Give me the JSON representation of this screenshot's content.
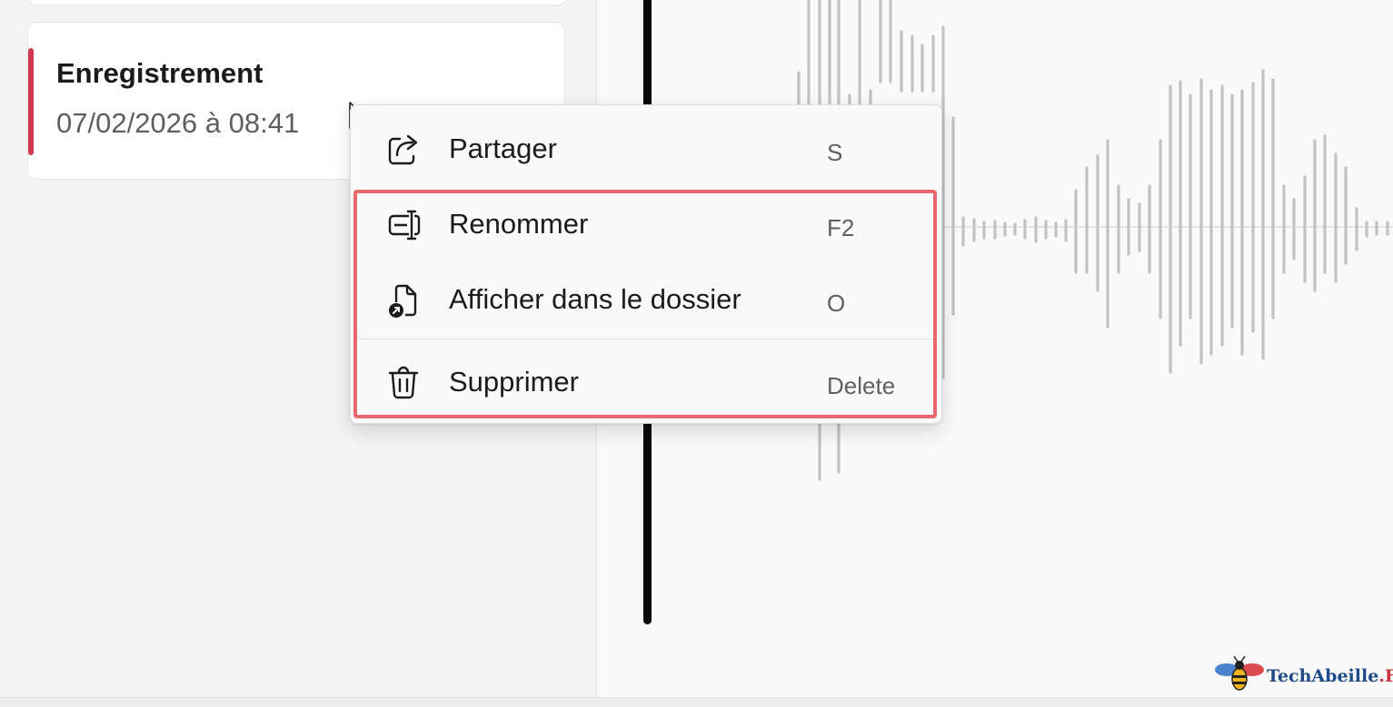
{
  "recording": {
    "title": "Enregistrement",
    "date": "07/02/2026 à 08:41"
  },
  "context_menu": {
    "items": [
      {
        "label": "Partager",
        "shortcut": "S",
        "icon": "share-icon"
      },
      {
        "label": "Renommer",
        "shortcut": "F2",
        "icon": "rename-icon"
      },
      {
        "label": "Afficher dans le dossier",
        "shortcut": "O",
        "icon": "open-file-location-icon"
      },
      {
        "label": "Supprimer",
        "shortcut": "Delete",
        "icon": "trash-icon"
      }
    ]
  },
  "watermark": {
    "name": "TechAbeille",
    "suffix": ".FR"
  },
  "colors": {
    "accent": "#d13a4e",
    "highlight": "#e8696b",
    "waveform": "#c2c2c2",
    "playhead": "#0a0a0a"
  }
}
